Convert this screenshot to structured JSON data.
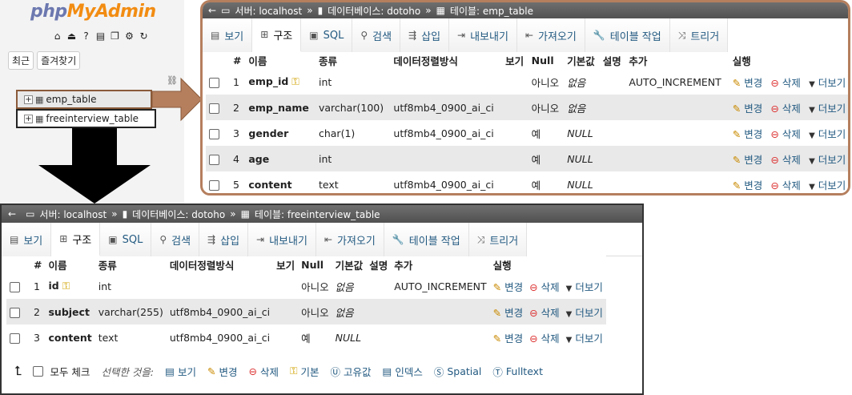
{
  "nav": {
    "logo_php": "php",
    "logo_rest": "MyAdmin",
    "tab_recent": "최근",
    "tab_favorites": "즐겨찾기",
    "tables": [
      "emp_table",
      "freeinterview_table"
    ]
  },
  "top": {
    "breadcrumb": {
      "server": "서버: localhost",
      "database": "데이터베이스: dotoho",
      "table": "테이블: emp_table",
      "sep": "»"
    },
    "tabs": [
      "보기",
      "구조",
      "SQL",
      "검색",
      "삽입",
      "내보내기",
      "가져오기",
      "테이블 작업",
      "트리거"
    ],
    "headers": [
      "#",
      "이름",
      "종류",
      "데이터정렬방식",
      "보기",
      "Null",
      "기본값",
      "설명",
      "추가",
      "실행"
    ],
    "rows": [
      {
        "num": "1",
        "name": "emp_id",
        "type": "int",
        "collation": "",
        "null": "아니오",
        "default": "없음",
        "extra": "AUTO_INCREMENT",
        "key": true
      },
      {
        "num": "2",
        "name": "emp_name",
        "type": "varchar(100)",
        "collation": "utf8mb4_0900_ai_ci",
        "null": "아니오",
        "default": "없음",
        "extra": "",
        "key": false
      },
      {
        "num": "3",
        "name": "gender",
        "type": "char(1)",
        "collation": "utf8mb4_0900_ai_ci",
        "null": "예",
        "default": "NULL",
        "extra": "",
        "key": false
      },
      {
        "num": "4",
        "name": "age",
        "type": "int",
        "collation": "",
        "null": "예",
        "default": "NULL",
        "extra": "",
        "key": false
      },
      {
        "num": "5",
        "name": "content",
        "type": "text",
        "collation": "utf8mb4_0900_ai_ci",
        "null": "예",
        "default": "NULL",
        "extra": "",
        "key": false
      }
    ]
  },
  "bottom": {
    "breadcrumb": {
      "server": "서버: localhost",
      "database": "데이터베이스: dotoho",
      "table": "테이블: freeinterview_table",
      "sep": "»"
    },
    "tabs": [
      "보기",
      "구조",
      "SQL",
      "검색",
      "삽입",
      "내보내기",
      "가져오기",
      "테이블 작업",
      "트리거"
    ],
    "headers": [
      "#",
      "이름",
      "종류",
      "데이터정렬방식",
      "보기",
      "Null",
      "기본값",
      "설명",
      "추가",
      "실행"
    ],
    "rows": [
      {
        "num": "1",
        "name": "id",
        "type": "int",
        "collation": "",
        "null": "아니오",
        "default": "없음",
        "extra": "AUTO_INCREMENT",
        "key": true
      },
      {
        "num": "2",
        "name": "subject",
        "type": "varchar(255)",
        "collation": "utf8mb4_0900_ai_ci",
        "null": "아니오",
        "default": "없음",
        "extra": "",
        "key": false
      },
      {
        "num": "3",
        "name": "content",
        "type": "text",
        "collation": "utf8mb4_0900_ai_ci",
        "null": "예",
        "default": "NULL",
        "extra": "",
        "key": false
      }
    ],
    "footer": {
      "check_all": "모두 체크",
      "with_selected": "선택한 것을:",
      "actions": [
        "보기",
        "변경",
        "삭제",
        "기본",
        "고유값",
        "인덱스",
        "Spatial",
        "Fulltext"
      ]
    }
  },
  "row_actions": {
    "change": "변경",
    "drop": "삭제",
    "more": "더보기"
  },
  "colors": {
    "accent_border": "#b57f5e",
    "link": "#235a81",
    "logo_php": "#6c78af",
    "logo_rest": "#f28c12"
  }
}
